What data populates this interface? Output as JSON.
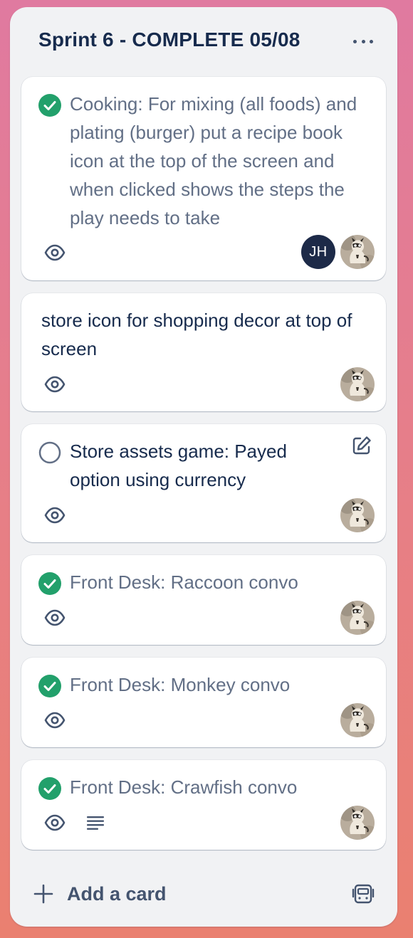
{
  "list": {
    "title": "Sprint 6 - COMPLETE 05/08",
    "menu_icon": "more-horizontal-icon"
  },
  "cards": [
    {
      "title": "Cooking: For mixing (all foods) and plating (burger) put a recipe book icon at the top of the screen and when clicked shows the steps the play needs to take",
      "status": "complete",
      "watching": true,
      "members": [
        "JH",
        "raccoon-photo"
      ]
    },
    {
      "title": "store icon for shopping decor at top of screen",
      "status": "none",
      "watching": true,
      "members": [
        "raccoon-photo"
      ]
    },
    {
      "title": "Store assets game: Payed option using currency",
      "status": "incomplete",
      "watching": true,
      "members": [
        "raccoon-photo"
      ]
    },
    {
      "title": "Front Desk: Raccoon convo",
      "status": "complete",
      "watching": true,
      "members": [
        "raccoon-photo"
      ]
    },
    {
      "title": "Front Desk: Monkey convo",
      "status": "complete",
      "watching": true,
      "members": [
        "raccoon-photo"
      ]
    },
    {
      "title": "Front Desk: Crawfish convo",
      "status": "complete",
      "watching": true,
      "has_description": true,
      "members": [
        "raccoon-photo"
      ]
    }
  ],
  "avatar_jh": {
    "initials": "JH"
  },
  "footer": {
    "add_label": "Add a card",
    "template_icon": "card-template-icon"
  },
  "colors": {
    "complete": "#22a06b",
    "list_bg": "#f1f2f4",
    "title": "#172b4d",
    "muted": "#626f86"
  }
}
